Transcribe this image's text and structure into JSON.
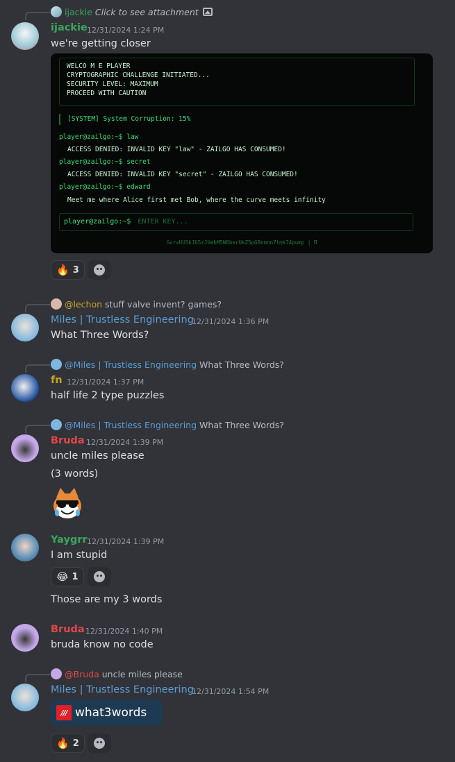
{
  "colors": {
    "ijackie": "#3ba55c",
    "miles": "#5b9bd5",
    "fn": "#c9a227",
    "bruda": "#e04848",
    "yaygrr": "#3ba55c",
    "lechon": "#c9a227"
  },
  "messages": {
    "m1": {
      "reply_user": "ijackie",
      "reply_text": "Click to see attachment",
      "reply_icon": "image-icon",
      "username": "ijackie",
      "timestamp": "12/31/2024 1:24 PM",
      "text": "we're getting closer"
    },
    "terminal": {
      "box_lines": [
        "WELCO          M  E PLAYER",
        "CRYPTOGRAPHIC CHALLENGE INITIATED...",
        "SECURITY LEVEL: MAXIMUM",
        "PROCEED WITH CAUTION"
      ],
      "system": "[SYSTEM] System Corruption: 15%",
      "cmd1": "player@zailgo:~$ law",
      "out1": "ACCESS DENIED: INVALID KEY \"law\" - ZAILGO HAS CONSUMED!",
      "cmd2": "player@zailgo:~$ secret",
      "out2": "ACCESS DENIED: INVALID KEY \"secret\" - ZAILGO HAS CONSUMED!",
      "cmd3": "player@zailgo:~$ edward",
      "out3": "Meet me where Alice first met Bob, where the curve meets infinity",
      "prompt": "player@zailgo:~$",
      "placeholder": "ENTER KEY...",
      "footer": "GorvUUSkJG5zJUebM5W6berUkZ5pG8nmnn7tmk74pump | Π"
    },
    "m1_reactions": [
      {
        "emoji": "🔥",
        "count": "3"
      }
    ],
    "m2": {
      "reply_user": "@lechon",
      "reply_text": "stuff valve invent? games?",
      "username": "Miles | Trustless Engineering",
      "timestamp": "12/31/2024 1:36 PM",
      "text": "What Three Words?"
    },
    "m3": {
      "reply_user": "@Miles | Trustless Engineering",
      "reply_text": "What Three Words?",
      "username": "fn",
      "timestamp": "12/31/2024 1:37 PM",
      "text": "half life 2 type puzzles"
    },
    "m4": {
      "reply_user": "@Miles | Trustless Engineering",
      "reply_text": "What Three Words?",
      "username": "Bruda",
      "timestamp": "12/31/2024 1:39 PM",
      "text": "uncle miles please",
      "text2": "(3 words)",
      "sticker": "cool-cat-emoji"
    },
    "m5": {
      "username": "Yaygrr",
      "timestamp": "12/31/2024 1:39 PM",
      "text": "I am stupid",
      "reaction_emoji": "😂",
      "reaction_count": "1",
      "text2": "Those are my 3 words"
    },
    "m6": {
      "username": "Bruda",
      "timestamp": "12/31/2024 1:40 PM",
      "text": "bruda know no code"
    },
    "m7": {
      "reply_user": "@Bruda",
      "reply_text": "uncle miles please",
      "username": "Miles | Trustless Engineering",
      "timestamp": "12/31/2024 1:54 PM",
      "embed_logo": "///",
      "embed_text": "what3words",
      "reaction_emoji": "🔥",
      "reaction_count": "2"
    }
  }
}
